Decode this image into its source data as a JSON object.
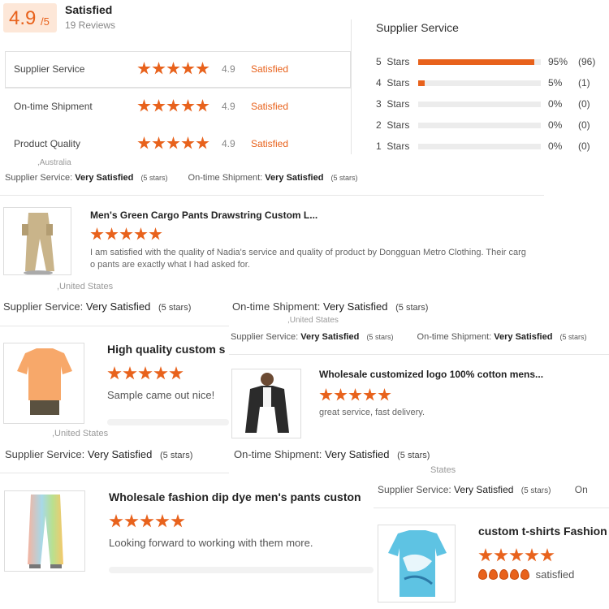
{
  "summary": {
    "score": "4.9",
    "score_max": "/5",
    "rating_word": "Satisfied",
    "reviews_count": "19 Reviews",
    "rows": [
      {
        "label": "Supplier Service",
        "score": "4.9",
        "word": "Satisfied",
        "stars": 5
      },
      {
        "label": "On-time Shipment",
        "score": "4.9",
        "word": "Satisfied",
        "stars": 5
      },
      {
        "label": "Product Quality",
        "score": "4.9",
        "word": "Satisfied",
        "stars": 5
      }
    ]
  },
  "breakdown": {
    "title": "Supplier Service",
    "rows": [
      {
        "label": "5  Stars",
        "fraction": 0.95,
        "pct": "95%",
        "count": "(96)"
      },
      {
        "label": "4  Stars",
        "fraction": 0.05,
        "pct": "5%",
        "count": "(1)"
      },
      {
        "label": "3  Stars",
        "fraction": 0,
        "pct": "0%",
        "count": "(0)"
      },
      {
        "label": "2  Stars",
        "fraction": 0,
        "pct": "0%",
        "count": "(0)"
      },
      {
        "label": "1  Stars",
        "fraction": 0,
        "pct": "0%",
        "count": "(0)"
      }
    ]
  },
  "labels": {
    "supplier_service": "Supplier Service: ",
    "ontime_shipment": "On-time Shipment: ",
    "very_satisfied": "Very Satisfied",
    "five_stars": "(5 stars)",
    "cut_off_on": "On"
  },
  "reviews": {
    "r0": {
      "location": ",Australia"
    },
    "r1": {
      "title": "Men's Green Cargo Pants Drawstring Custom L...",
      "text": "I am satisfied with the quality of Nadia's service and quality of product by Dongguan Metro Clothing. Their cargo pants are exactly what I had asked for.",
      "location": ",United States",
      "stars": 5
    },
    "r2": {
      "title": "High quality custom s",
      "text": "Sample came out nice!",
      "location": ",United States",
      "stars": 5
    },
    "r3": {
      "title": "Wholesale customized logo 100% cotton mens...",
      "text": "great service, fast delivery.",
      "location": ",United States",
      "stars": 5
    },
    "r4": {
      "title": "Wholesale fashion dip dye men's pants custon",
      "text": "Looking forward to working with them more.",
      "stars": 5
    },
    "r5": {
      "title": "custom t-shirts Fashion",
      "text": "satisfied",
      "location": "States",
      "stars": 5
    }
  },
  "colors": {
    "accent": "#e8621c",
    "badge_bg": "#fde7d8"
  }
}
